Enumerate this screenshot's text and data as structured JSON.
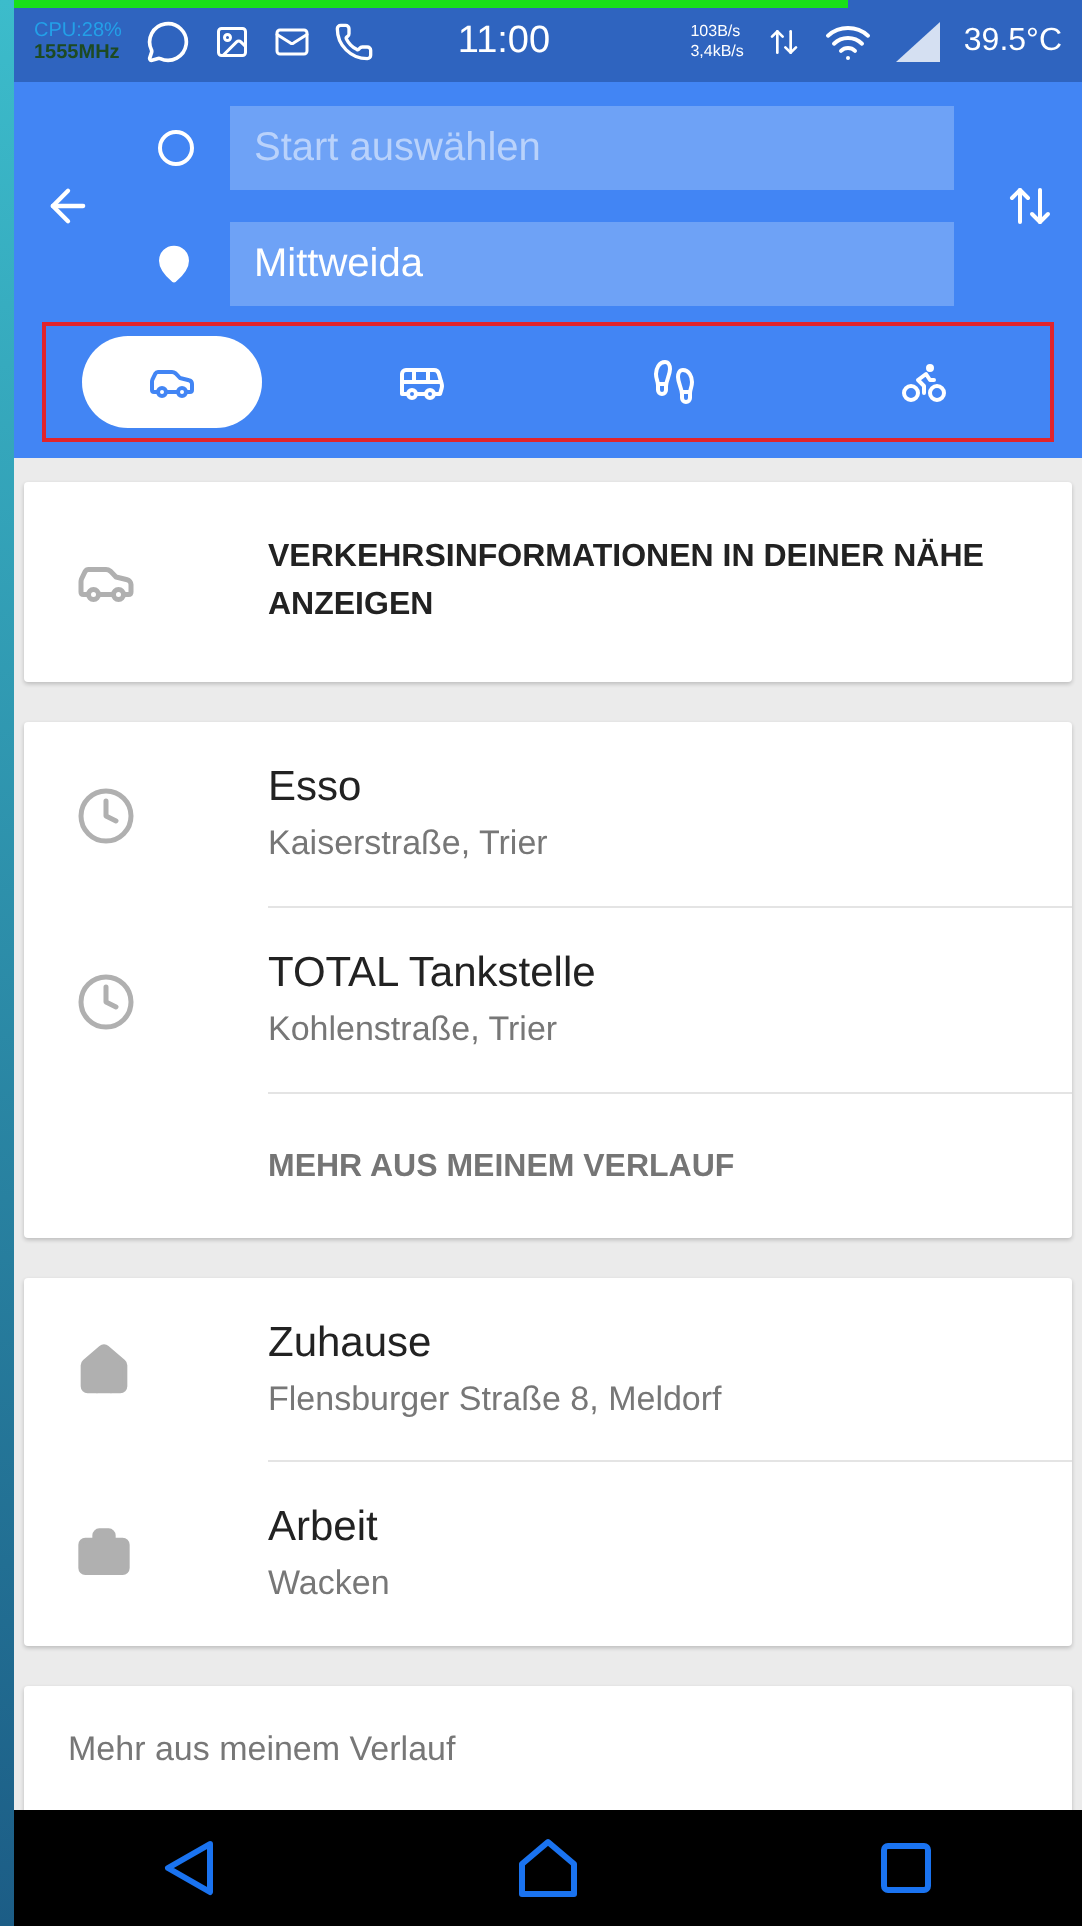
{
  "status_bar": {
    "cpu": "CPU:28%",
    "frequency": "1555MHz",
    "time": "11:00",
    "upload_rate": "103B/s",
    "download_rate": "3,4kB/s",
    "temperature": "39.5°C",
    "progress": {
      "level": 0.78
    }
  },
  "directions": {
    "start": {
      "placeholder": "Start auswählen"
    },
    "destination": {
      "value": "Mittweida"
    }
  },
  "modes": [
    {
      "kind": "car",
      "selected": true
    },
    {
      "kind": "transit",
      "selected": false
    },
    {
      "kind": "walk",
      "selected": false
    },
    {
      "kind": "bike",
      "selected": false
    }
  ],
  "traffic_card": {
    "label": "VERKEHRSINFORMATIONEN IN DEINER NÄHE ANZEIGEN"
  },
  "history": {
    "items": [
      {
        "title": "Esso",
        "subtitle": "Kaiserstraße, Trier"
      },
      {
        "title": "TOTAL Tankstelle",
        "subtitle": "Kohlenstraße, Trier"
      }
    ],
    "more": "MEHR AUS MEINEM VERLAUF"
  },
  "places": [
    {
      "kind": "home",
      "title": "Zuhause",
      "subtitle": "Flensburger Straße 8, Meldorf"
    },
    {
      "kind": "work",
      "title": "Arbeit",
      "subtitle": "Wacken"
    }
  ],
  "last_card": {
    "label": "Mehr aus meinem Verlauf"
  }
}
